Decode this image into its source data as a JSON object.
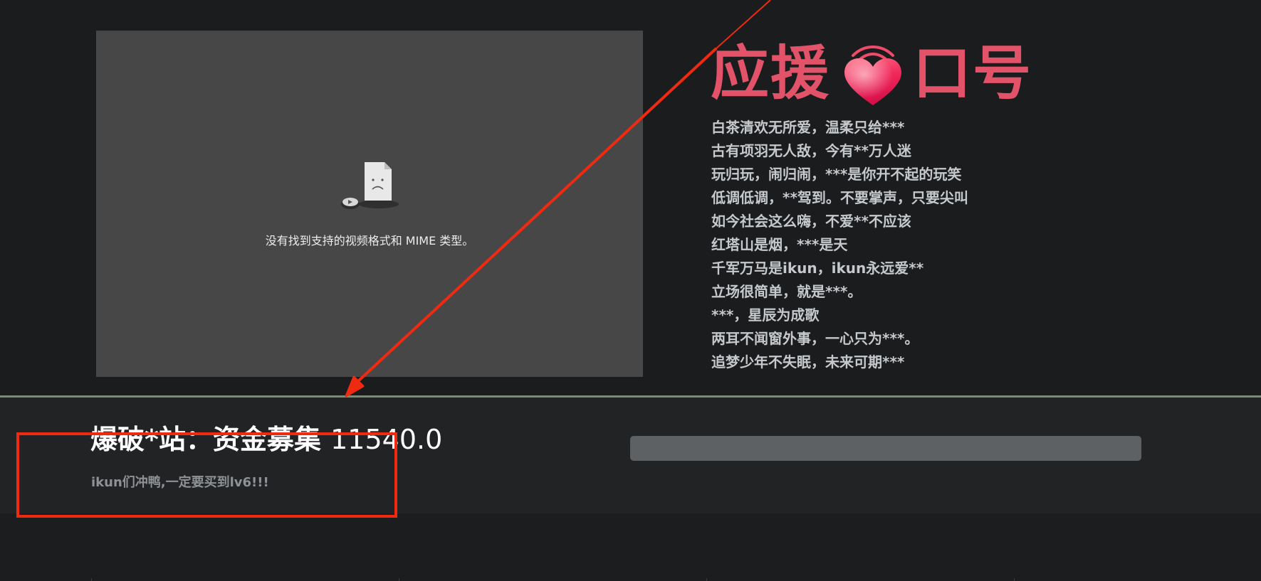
{
  "video": {
    "error_message": "没有找到支持的视频格式和 MIME 类型。",
    "icon": "sad-file-icon"
  },
  "cheer": {
    "title_left": "应援",
    "title_right": "口号",
    "heart_icon": "heart-wifi-icon",
    "slogans": [
      "白茶清欢无所爱，温柔只给***",
      "古有项羽无人敌，今有**万人迷",
      "玩归玩，闹归闹，***是你开不起的玩笑",
      "低调低调，**驾到。不要掌声，只要尖叫",
      "如今社会这么嗨，不爱**不应该",
      "红塔山是烟，***是天",
      "千军万马是ikun，ikun永远爱**",
      "立场很简单，就是***。",
      "***，星辰为成歌",
      "两耳不闻窗外事，一心只为***。",
      "追梦少年不失眠，未来可期***"
    ],
    "title_color": "#e2536a"
  },
  "funding": {
    "title": "爆破*站：资金募集",
    "amount": "11540.0",
    "subtitle": "ikun们冲鸭,一定要买到lv6!!!",
    "progress": 0
  },
  "annotation": {
    "color": "#f02a10"
  }
}
